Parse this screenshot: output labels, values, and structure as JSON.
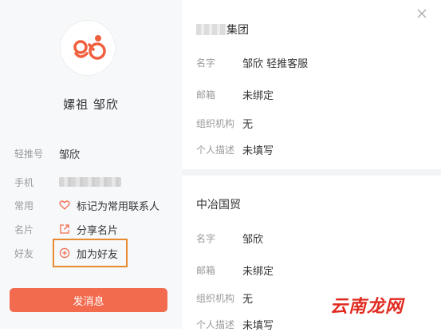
{
  "profile": {
    "name": "嫘祖 邹欣"
  },
  "info": {
    "account": {
      "label": "轻推号",
      "value": "邹欣"
    },
    "phone": {
      "label": "手机"
    },
    "frequent": {
      "label": "常用",
      "value": "标记为常用联系人"
    },
    "card": {
      "label": "名片",
      "value": "分享名片"
    },
    "friend": {
      "label": "好友",
      "value": "加为好友"
    }
  },
  "send_button": "发消息",
  "orgs": [
    {
      "title_suffix": "集团",
      "rows": [
        {
          "label": "名字",
          "value": "邹欣 轻推客服"
        },
        {
          "label": "邮箱",
          "value": "未绑定"
        },
        {
          "label": "组织机构",
          "value": "无"
        },
        {
          "label": "个人描述",
          "value": "未填写"
        }
      ]
    },
    {
      "title": "中冶国贸",
      "rows": [
        {
          "label": "名字",
          "value": "邹欣"
        },
        {
          "label": "邮箱",
          "value": "未绑定"
        },
        {
          "label": "组织机构",
          "value": "无"
        },
        {
          "label": "个人描述",
          "value": "未填写"
        }
      ]
    }
  ],
  "watermark": "云南龙网",
  "colors": {
    "accent": "#f26b4f",
    "highlight_box": "#e88a2e",
    "brand_icon": "#f0603e"
  },
  "icons": {
    "avatar": "qingtui-logo-icon",
    "frequent": "heart-outline-icon",
    "card": "share-icon",
    "friend": "add-circle-icon",
    "close": "close-icon"
  }
}
